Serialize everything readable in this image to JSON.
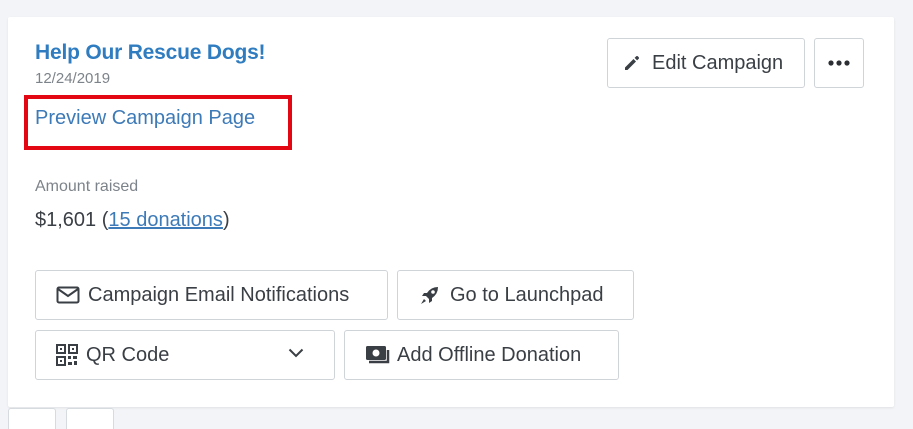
{
  "campaign": {
    "title": "Help Our Rescue Dogs!",
    "date": "12/24/2019",
    "preview_link": "Preview Campaign Page",
    "amount_label": "Amount raised",
    "amount_value": "$1,601",
    "donations_link": "15 donations"
  },
  "actions": {
    "edit_label": "Edit Campaign",
    "more_icon": "more-horizontal-icon",
    "email_label": "Campaign Email Notifications",
    "launchpad_label": "Go to Launchpad",
    "qr_label": "QR Code",
    "offline_label": "Add Offline Donation"
  },
  "colors": {
    "title": "#2f7dc0",
    "link": "#3d7ab8",
    "highlight": "#e30613"
  }
}
